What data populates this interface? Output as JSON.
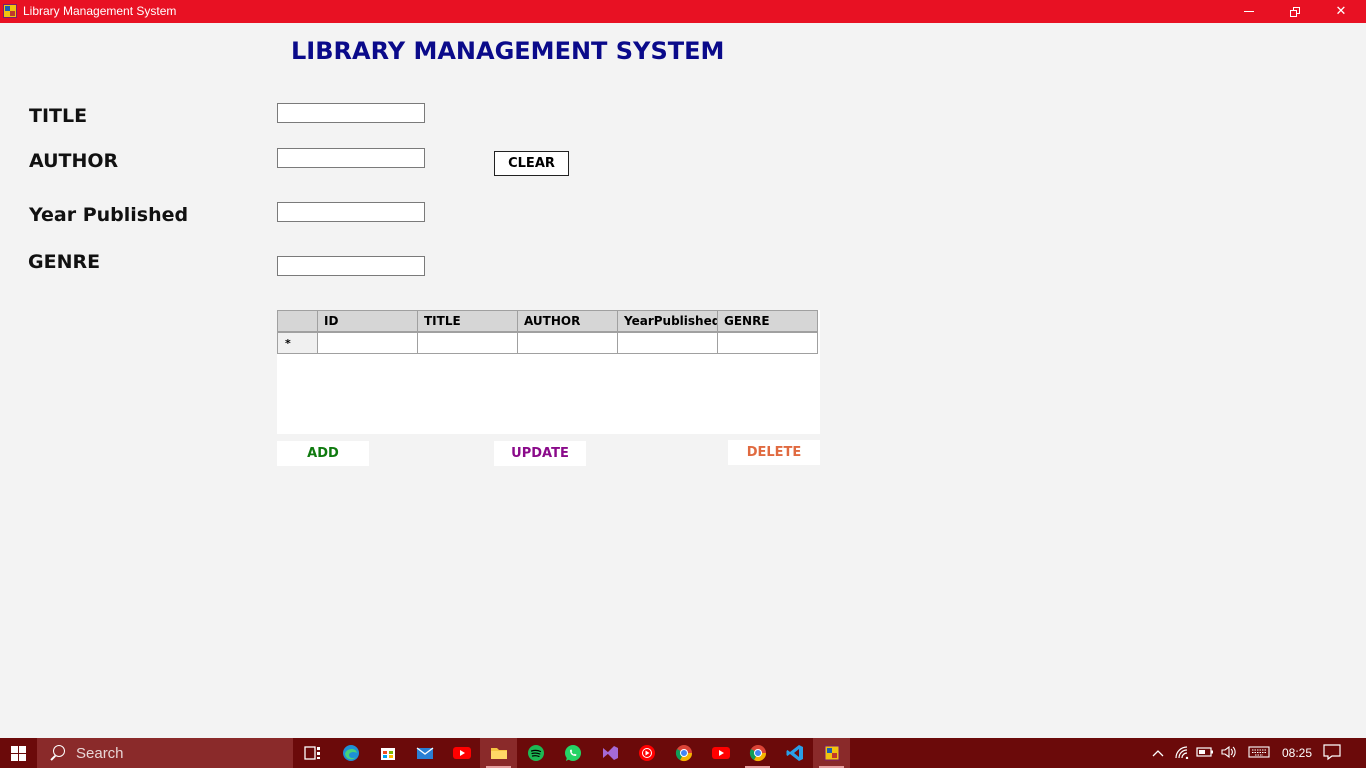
{
  "window": {
    "title": "Library Management System"
  },
  "form": {
    "heading": "LIBRARY MANAGEMENT SYSTEM",
    "labels": {
      "title": "TITLE",
      "author": "AUTHOR",
      "year": "Year Published",
      "genre": "GENRE"
    },
    "values": {
      "title": "",
      "author": "",
      "year": "",
      "genre": ""
    },
    "clear_label": "CLEAR"
  },
  "grid": {
    "columns": [
      "ID",
      "TITLE",
      "AUTHOR",
      "YearPublished",
      "GENRE"
    ],
    "new_row_marker": "*",
    "rows": []
  },
  "actions": {
    "add": "ADD",
    "update": "UPDATE",
    "delete": "DELETE"
  },
  "colors": {
    "titlebar": "#e81123",
    "heading": "#0a0a8a",
    "add": "#0f7a0f",
    "update": "#8a0a8a",
    "delete": "#e06a40",
    "taskbar": "#6b0a0a"
  },
  "taskbar": {
    "search_placeholder": "Search",
    "pinned_icons": [
      "task-view-icon",
      "edge-icon",
      "store-icon",
      "mail-icon",
      "youtube-icon",
      "file-explorer-icon",
      "spotify-icon",
      "whatsapp-icon",
      "visual-studio-icon",
      "youtube-music-icon",
      "chrome-icon",
      "youtube-icon",
      "chrome-icon",
      "vscode-icon",
      "library-app-icon"
    ],
    "clock": "08:25"
  }
}
